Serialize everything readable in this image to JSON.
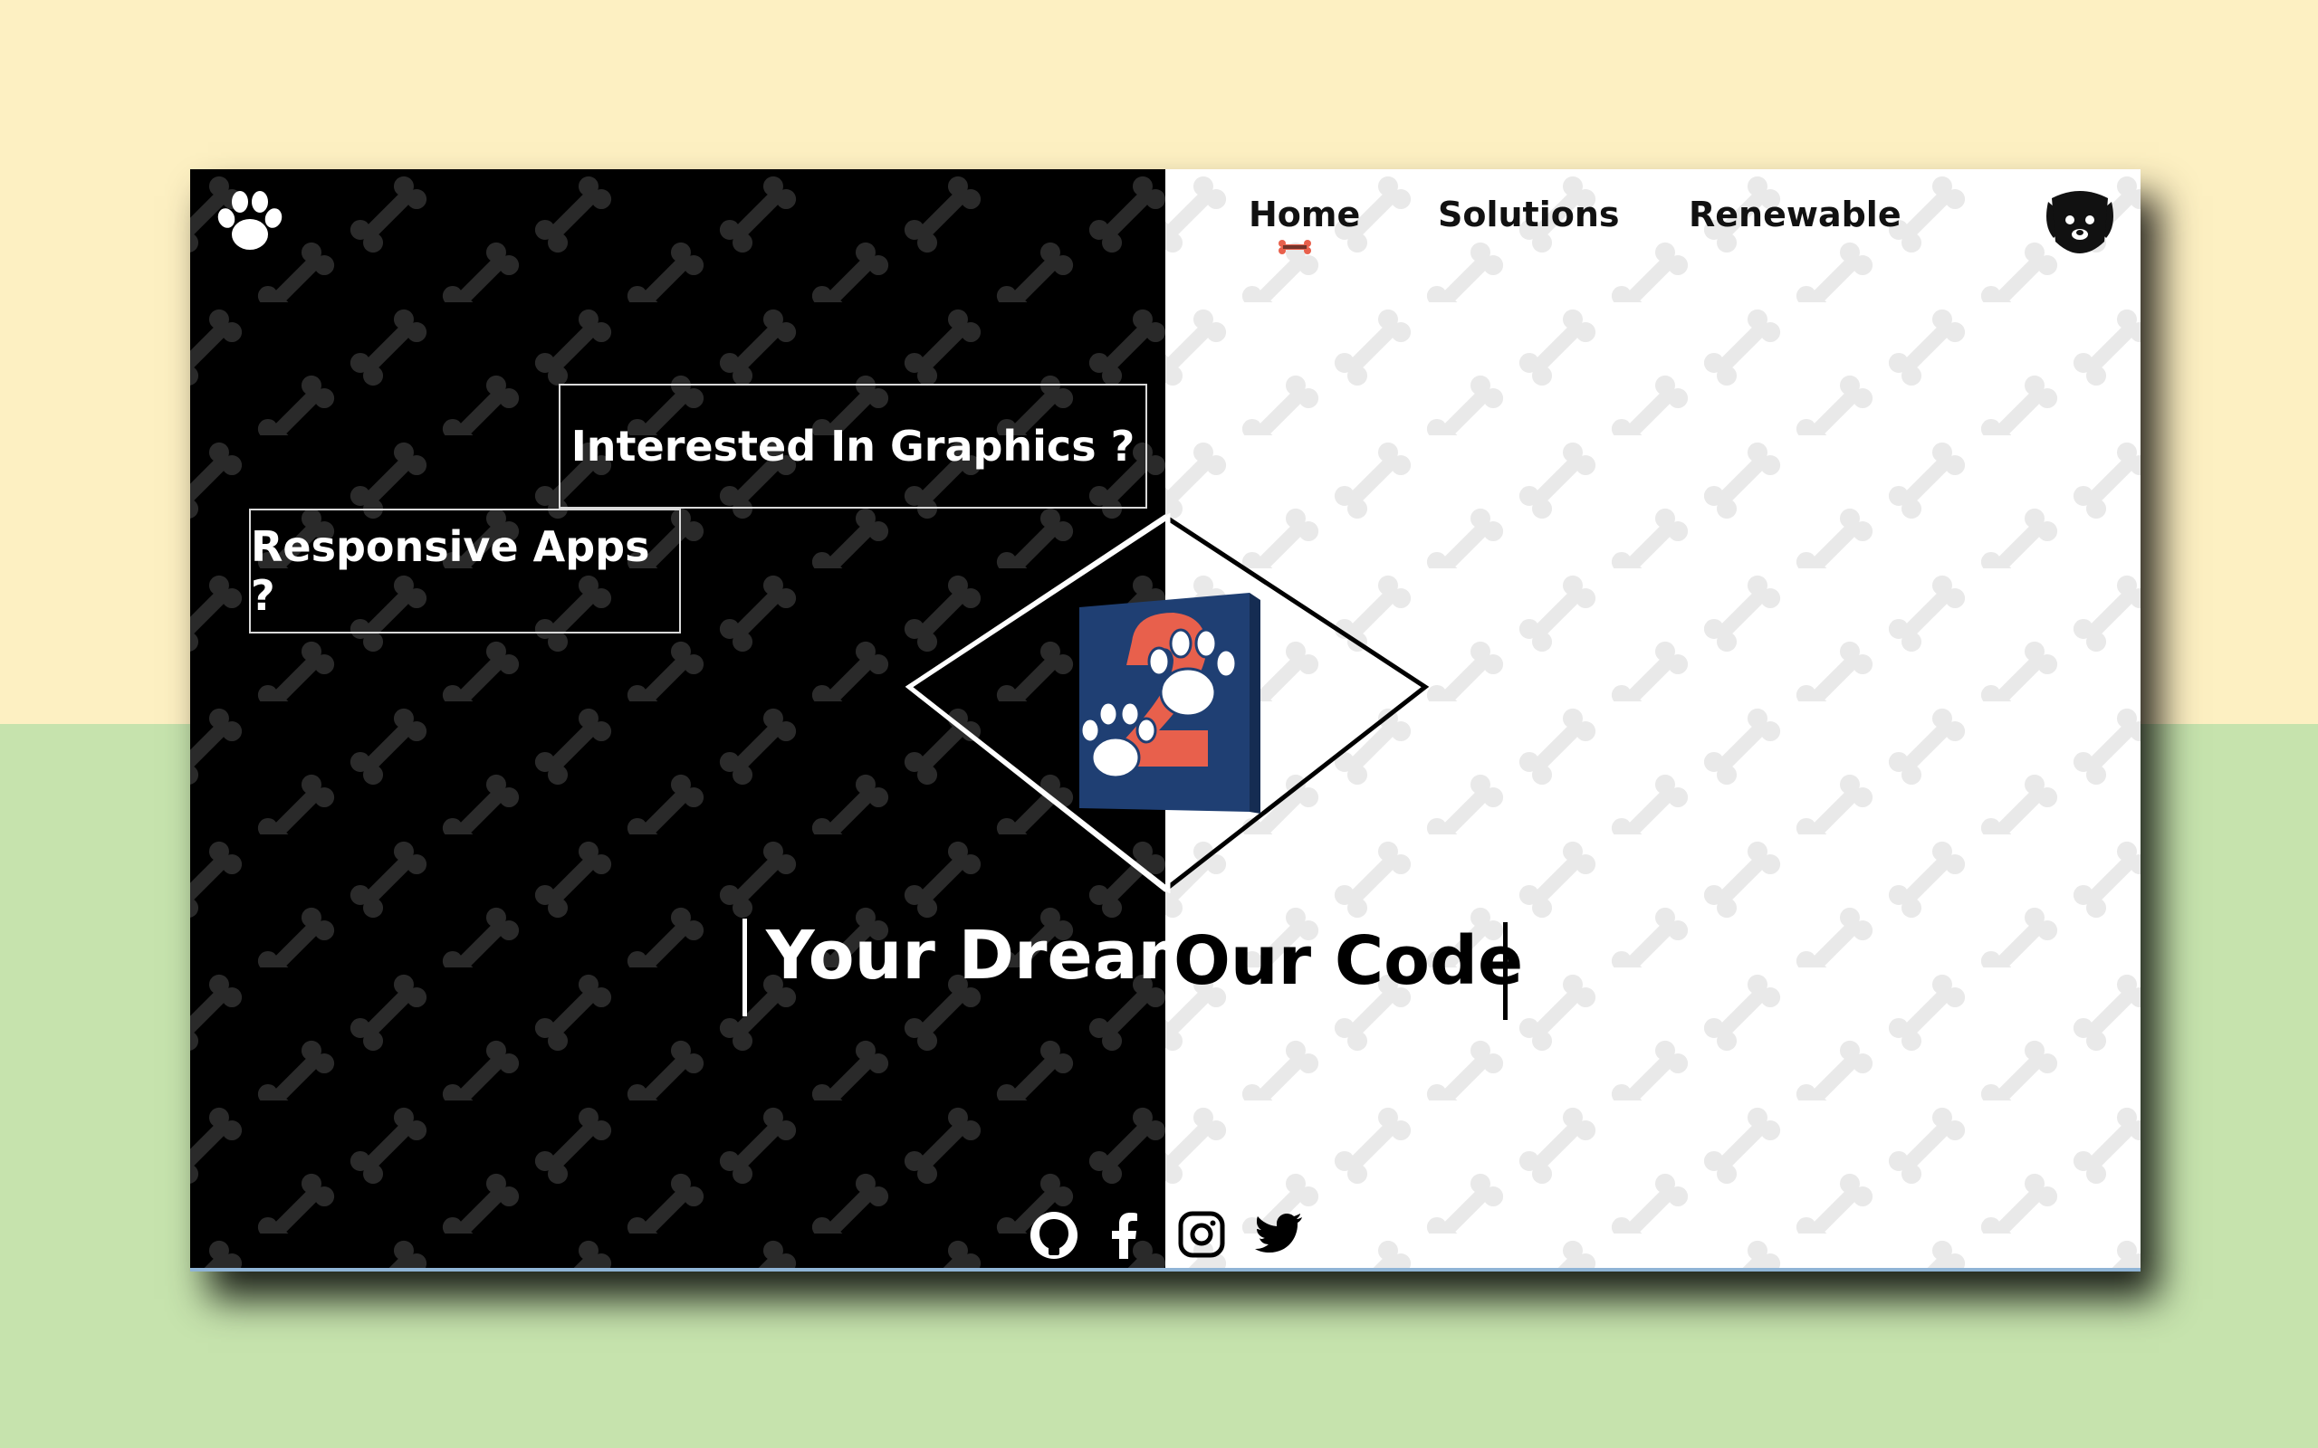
{
  "colors": {
    "background_top": "#fdf0c2",
    "background_bottom": "#c6e3ad",
    "left_panel": "#000000",
    "right_panel": "#ffffff",
    "left_bone_pattern": "#2a2a2a",
    "right_bone_pattern": "#e9e9e9",
    "accent_red": "#e8604c",
    "logo_blue": "#1f3f73"
  },
  "nav": {
    "items": [
      {
        "label": "Home",
        "active": true
      },
      {
        "label": "Solutions",
        "active": false
      },
      {
        "label": "Renewable",
        "active": false
      }
    ]
  },
  "hero": {
    "question_graphics": "Interested In Graphics ?",
    "question_apps": "Responsive Apps ?",
    "tagline_left": "Your Dream",
    "tagline_right": "Our Code"
  },
  "icons": {
    "brand": "paw-icon",
    "profile": "dog-face-icon",
    "logo": "paw-logo-icon",
    "social": [
      "github-icon",
      "facebook-icon",
      "instagram-icon",
      "twitter-icon"
    ]
  }
}
